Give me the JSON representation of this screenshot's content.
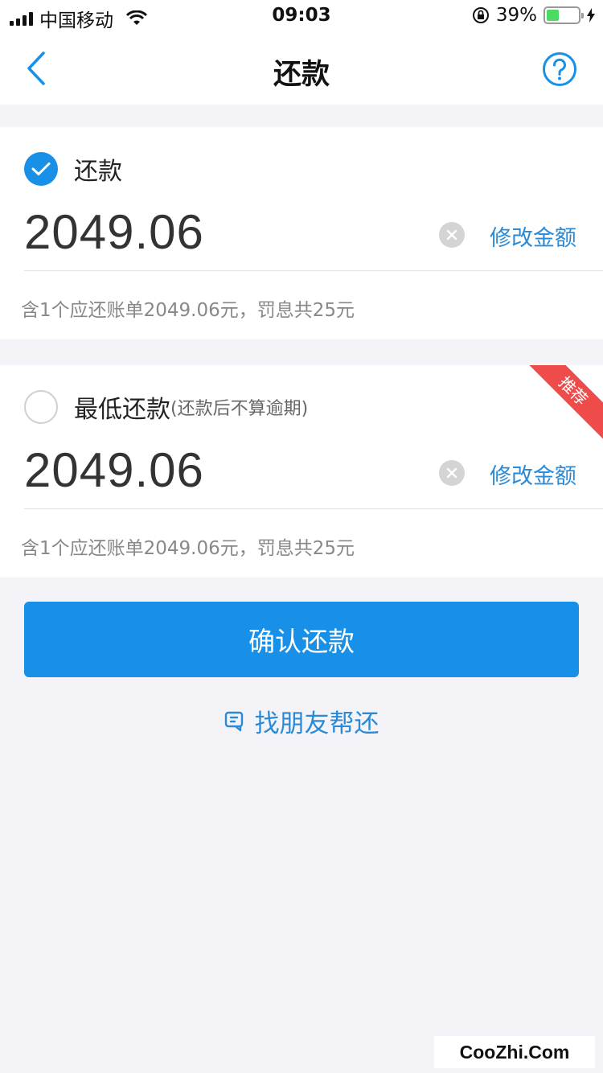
{
  "status_bar": {
    "carrier": "中国移动",
    "time": "09:03",
    "battery_text": "39%",
    "battery_level": 0.39
  },
  "nav": {
    "title": "还款"
  },
  "option_full": {
    "label": "还款",
    "selected": true,
    "amount": "2049.06",
    "edit_label": "修改金额",
    "note": "含1个应还账单2049.06元，罚息共25元"
  },
  "option_min": {
    "label": "最低还款",
    "sub_label": "(还款后不算逾期)",
    "selected": false,
    "badge": "推荐",
    "amount": "2049.06",
    "edit_label": "修改金额",
    "note": "含1个应还账单2049.06元，罚息共25元"
  },
  "actions": {
    "confirm_label": "确认还款",
    "friend_label": "找朋友帮还"
  },
  "watermark": "CooZhi.Com",
  "colors": {
    "accent": "#1890e8",
    "link": "#2a8ad6",
    "badge": "#ee4b4b",
    "background": "#f4f4f8"
  }
}
